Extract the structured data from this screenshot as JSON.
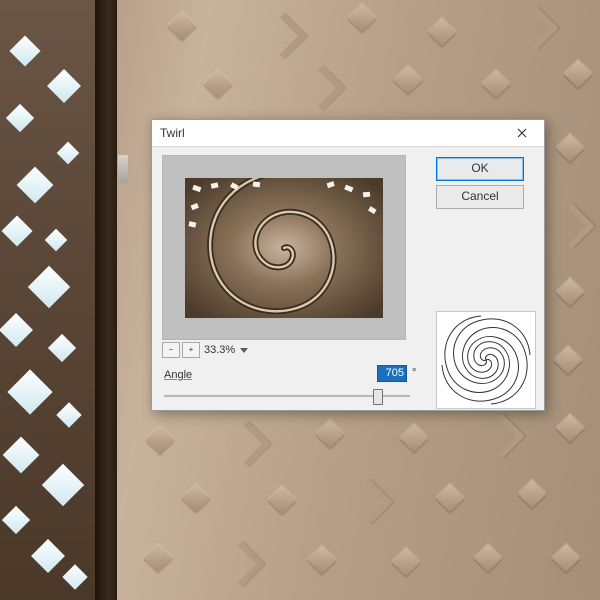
{
  "dialog": {
    "title": "Twirl",
    "ok_label": "OK",
    "cancel_label": "Cancel",
    "angle_label": "Angle",
    "angle_value": "705",
    "angle_degree_symbol": "°",
    "zoom_pct": "33.3%",
    "zoom_minus": "−",
    "zoom_plus": "+",
    "slider_min": -999,
    "slider_max": 999,
    "slider_value": 705
  }
}
